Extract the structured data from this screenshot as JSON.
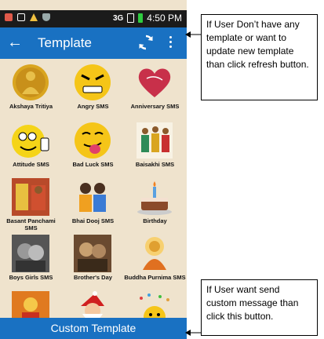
{
  "status_bar": {
    "network": "3G",
    "time": "4:50 PM"
  },
  "app_bar": {
    "back_icon": "arrow-left-icon",
    "title": "Template",
    "refresh_icon": "refresh-icon",
    "menu_icon": "more-vert-icon"
  },
  "templates": [
    {
      "label": "Akshaya Tritiya",
      "icon": "goddess-coin-icon"
    },
    {
      "label": "Angry SMS",
      "icon": "angry-emoji-icon"
    },
    {
      "label": "Anniversary SMS",
      "icon": "heart-icon"
    },
    {
      "label": "Attitude SMS",
      "icon": "thumbs-up-emoji-icon"
    },
    {
      "label": "Bad Luck SMS",
      "icon": "tongue-emoji-icon"
    },
    {
      "label": "Baisakhi SMS",
      "icon": "baisakhi-dancers-icon"
    },
    {
      "label": "Basant Panchami SMS",
      "icon": "basant-photo-icon"
    },
    {
      "label": "Bhai Dooj SMS",
      "icon": "siblings-icon"
    },
    {
      "label": "Birthday",
      "icon": "cake-icon"
    },
    {
      "label": "Boys Girls SMS",
      "icon": "couple-photo-icon"
    },
    {
      "label": "Brother's Day",
      "icon": "brothers-photo-icon"
    },
    {
      "label": "Buddha Purnima SMS",
      "icon": "buddha-icon"
    },
    {
      "label": "",
      "icon": "deity-icon"
    },
    {
      "label": "",
      "icon": "santa-icon"
    },
    {
      "label": "",
      "icon": "emoji-party-icon"
    }
  ],
  "bottom_bar": {
    "label": "Custom Template"
  },
  "callouts": {
    "refresh": "If User Don’t have any template or want to update new template than click refresh button.",
    "custom": "If User want send custom message than click this button."
  },
  "colors": {
    "primary": "#1971c2",
    "background": "#efe3cd",
    "status_bar": "#1b1b1b"
  }
}
